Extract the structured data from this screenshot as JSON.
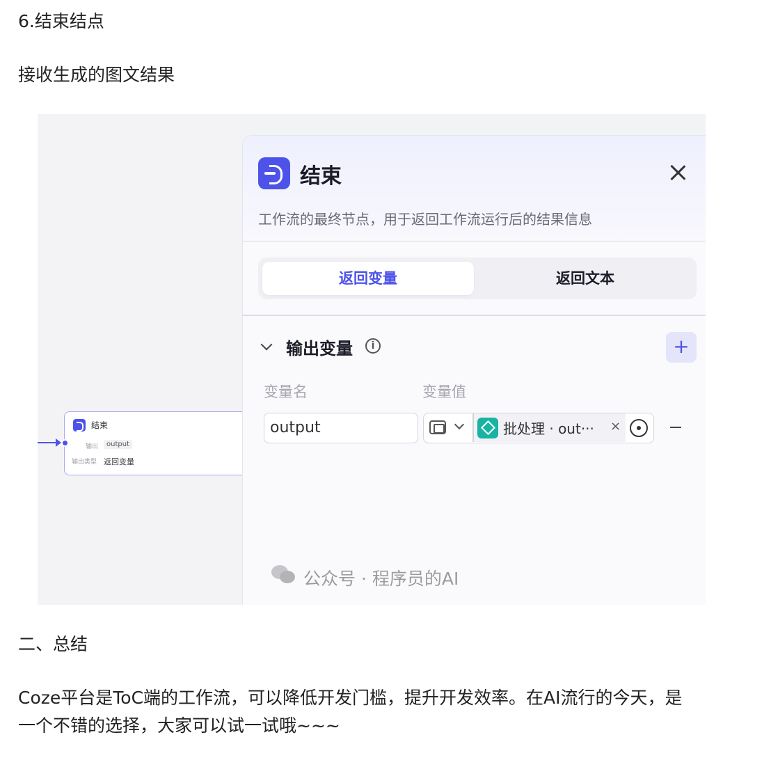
{
  "article": {
    "heading_6": "6.结束结点",
    "paragraph_1": "接收生成的图文结果",
    "heading_2": "二、总结",
    "summary_line_1": "Coze平台是ToC端的工作流，可以降低开发门槛，提升开发效率。在AI流行的今天，是",
    "summary_line_2": "一个不错的选择，大家可以试一试哦~~~"
  },
  "screenshot": {
    "canvas_node": {
      "icon": "end-node-icon",
      "title": "结束",
      "row1_label": "输出",
      "row1_value": "output",
      "row2_label": "输出类型",
      "row2_value": "返回变量"
    },
    "panel": {
      "icon": "end-node-icon",
      "title": "结束",
      "close_icon": "close-icon",
      "description": "工作流的最终节点，用于返回工作流运行后的结果信息",
      "tabs": [
        {
          "label": "返回变量",
          "active": true
        },
        {
          "label": "返回文本",
          "active": false
        }
      ],
      "section": {
        "title": "输出变量",
        "info_icon": "ⓘ",
        "add_label": "+",
        "col_name": "变量名",
        "col_value": "变量值",
        "row": {
          "name": "output",
          "type_icon": "image-list-icon",
          "ref_icon": "batch-layers-icon",
          "ref_text": "批处理 · out···",
          "ref_remove": "×",
          "remove_label": ""
        }
      }
    },
    "watermark": "公众号 · 程序员的AI",
    "colors": {
      "accent": "#4d53e8",
      "batch": "#18b3a2"
    }
  }
}
